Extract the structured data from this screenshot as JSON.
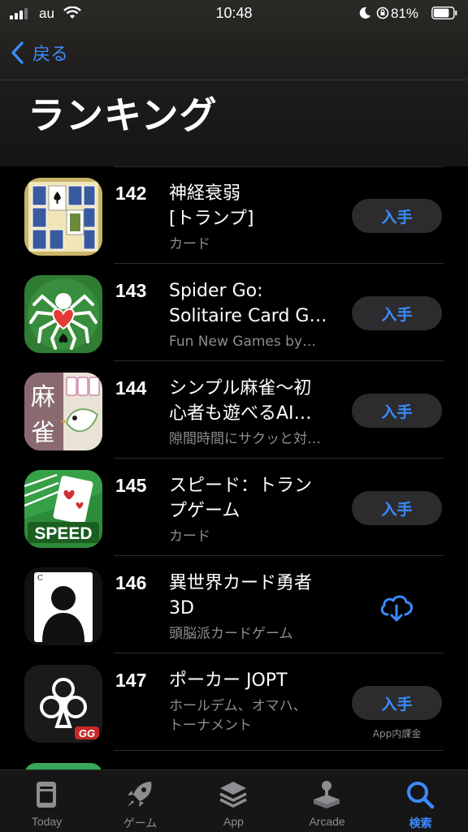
{
  "status": {
    "carrier": "au",
    "time": "10:48",
    "battery_percent": "81%",
    "battery_level": 0.81
  },
  "nav": {
    "back_label": "戻る",
    "title": "ランキング"
  },
  "apps": [
    {
      "rank": "142",
      "title": "神経衰弱\n[トランプ]",
      "subtitle": "カード",
      "action": "get",
      "button": "入手",
      "icon": "card-game-icon"
    },
    {
      "rank": "143",
      "title": "Spider Go:\nSolitaire Card G…",
      "subtitle": "Fun New Games by…",
      "action": "get",
      "button": "入手",
      "icon": "spider-solitaire-icon"
    },
    {
      "rank": "144",
      "title": "シンプル麻雀〜初\n心者も遊べるAI…",
      "subtitle": "隙間時間にサクッと対…",
      "action": "get",
      "button": "入手",
      "icon": "mahjong-icon"
    },
    {
      "rank": "145",
      "title": "スピード：トラン\nプゲーム",
      "subtitle": "カード",
      "action": "get",
      "button": "入手",
      "icon": "speed-card-icon",
      "icon_text": "SPEED"
    },
    {
      "rank": "146",
      "title": "異世界カード勇者\n3D",
      "subtitle": "頭脳派カードゲーム",
      "action": "download",
      "icon": "silhouette-card-icon"
    },
    {
      "rank": "147",
      "title": "ポーカー JOPT",
      "subtitle": "ホールデム、オマハ、\nトーナメント",
      "action": "get",
      "button": "入手",
      "note": "App内課金",
      "icon": "poker-club-icon",
      "icon_text": "GG"
    }
  ],
  "tabs": [
    {
      "label": "Today",
      "icon": "today-icon",
      "active": false
    },
    {
      "label": "ゲーム",
      "icon": "rocket-icon",
      "active": false
    },
    {
      "label": "App",
      "icon": "layers-icon",
      "active": false
    },
    {
      "label": "Arcade",
      "icon": "joystick-icon",
      "active": false
    },
    {
      "label": "検索",
      "icon": "search-icon",
      "active": true
    }
  ],
  "colors": {
    "accent": "#3b8bff",
    "button_bg": "#2c2c2e",
    "secondary_text": "#8d8d92"
  }
}
